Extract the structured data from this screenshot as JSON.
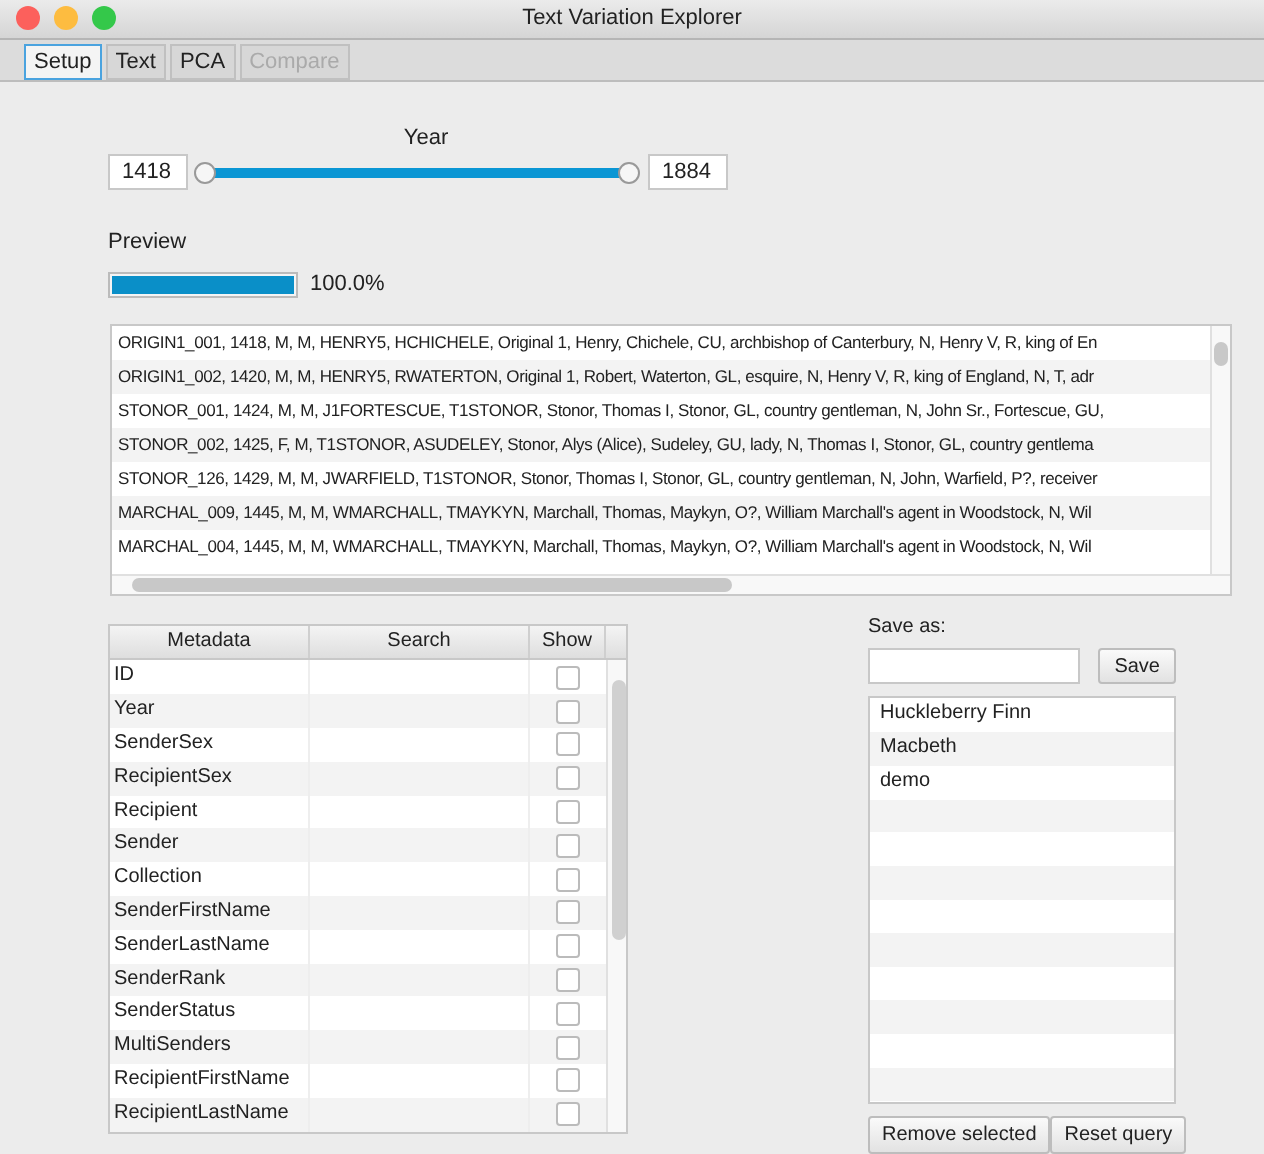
{
  "window": {
    "title": "Text Variation Explorer"
  },
  "tabs": [
    {
      "label": "Setup",
      "selected": true,
      "disabled": false
    },
    {
      "label": "Text",
      "selected": false,
      "disabled": false
    },
    {
      "label": "PCA",
      "selected": false,
      "disabled": false
    },
    {
      "label": "Compare",
      "selected": false,
      "disabled": true
    }
  ],
  "year_range": {
    "label": "Year",
    "from": "1418",
    "to": "1884",
    "level": 1
  },
  "preview": {
    "label": "Preview",
    "level": 1,
    "reading": "100.0%"
  },
  "text_rows": [
    "ORIGIN1_001, 1418, M, M, HENRY5, HCHICHELE, Original 1, Henry, Chichele, CU, archbishop of Canterbury, N, Henry V, R, king of En",
    "ORIGIN1_002, 1420, M, M, HENRY5, RWATERTON, Original 1, Robert, Waterton, GL, esquire, N, Henry V, R, king of England, N, T, adr",
    "STONOR_001, 1424, M, M, J1FORTESCUE, T1STONOR, Stonor, Thomas I, Stonor, GL, country gentleman, N, John Sr., Fortescue, GU,",
    "STONOR_002, 1425, F, M, T1STONOR, ASUDELEY, Stonor, Alys (Alice), Sudeley, GU, lady, N, Thomas I, Stonor, GL, country gentlema",
    "STONOR_126, 1429, M, M, JWARFIELD, T1STONOR, Stonor, Thomas I, Stonor, GL, country gentleman, N, John, Warfield, P?, receiver",
    "MARCHAL_009, 1445, M, M, WMARCHALL, TMAYKYN, Marchall, Thomas, Maykyn, O?, William Marchall's agent in Woodstock, N, Wil",
    "MARCHAL_004, 1445, M, M, WMARCHALL, TMAYKYN, Marchall, Thomas, Maykyn, O?, William Marchall's agent in Woodstock, N, Wil"
  ],
  "metadata_table": {
    "columns": [
      "Metadata",
      "Search",
      "Show"
    ],
    "rows": [
      {
        "name": "ID",
        "show": false
      },
      {
        "name": "Year",
        "show": false
      },
      {
        "name": "SenderSex",
        "show": false
      },
      {
        "name": "RecipientSex",
        "show": false
      },
      {
        "name": "Recipient",
        "show": false
      },
      {
        "name": "Sender",
        "show": false
      },
      {
        "name": "Collection",
        "show": false
      },
      {
        "name": "SenderFirstName",
        "show": false
      },
      {
        "name": "SenderLastName",
        "show": false
      },
      {
        "name": "SenderRank",
        "show": false
      },
      {
        "name": "SenderStatus",
        "show": false
      },
      {
        "name": "MultiSenders",
        "show": false
      },
      {
        "name": "RecipientFirstName",
        "show": false
      },
      {
        "name": "RecipientLastName",
        "show": false
      }
    ]
  },
  "save": {
    "label": "Save as:",
    "button": "Save"
  },
  "saved_queries": [
    "Huckleberry Finn",
    "Macbeth",
    "demo"
  ],
  "buttons": [
    "Remove selected",
    "Reset query"
  ]
}
